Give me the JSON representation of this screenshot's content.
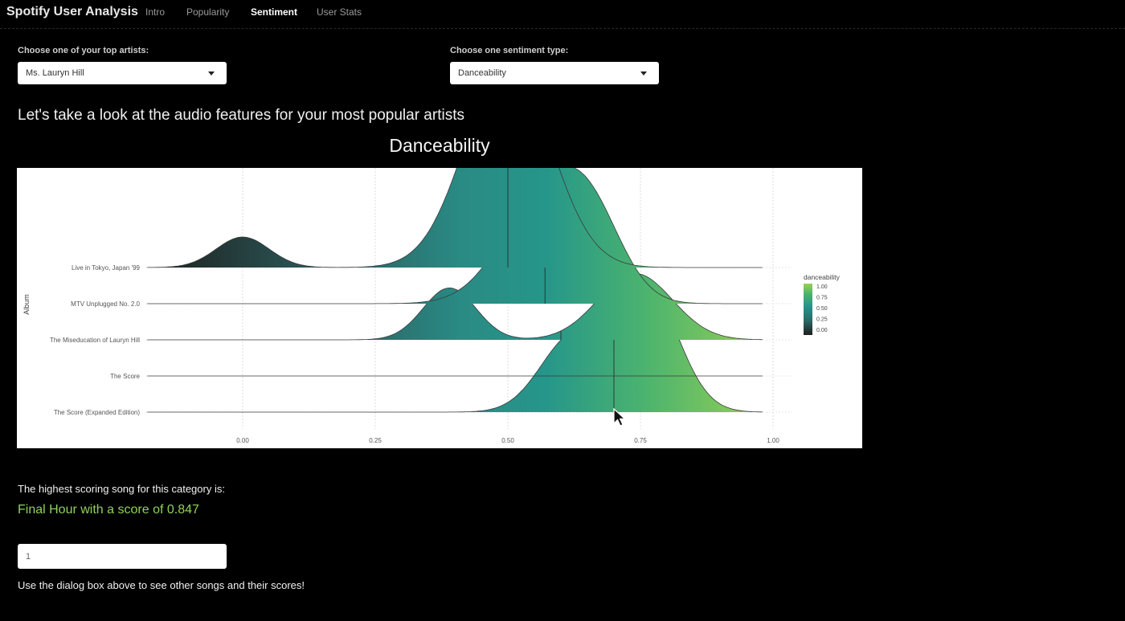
{
  "app": {
    "title": "Spotify User Analysis",
    "tabs": [
      {
        "label": "Intro",
        "active": false
      },
      {
        "label": "Popularity",
        "active": false
      },
      {
        "label": "Sentiment",
        "active": true
      },
      {
        "label": "User Stats",
        "active": false
      }
    ]
  },
  "controls": {
    "artist_label": "Choose one of your top artists:",
    "artist_value": "Ms. Lauryn Hill",
    "sentiment_label": "Choose one sentiment type:",
    "sentiment_value": "Danceability"
  },
  "main": {
    "heading": "Let's take a look at the audio features for your most popular artists",
    "chart_title": "Danceability"
  },
  "chart_data": {
    "type": "ridgeline",
    "title": "Danceability",
    "xlabel": "",
    "ylabel": "Album",
    "xlim": [
      -0.2,
      1.03
    ],
    "x_ticks": [
      0.0,
      0.25,
      0.5,
      0.75,
      1.0
    ],
    "x_tick_labels": [
      "0.00",
      "0.25",
      "0.50",
      "0.75",
      "1.00"
    ],
    "categories": [
      "Live in Tokyo, Japan '99",
      "MTV Unplugged No. 2.0",
      "The Miseducation of Lauryn Hill",
      "The Score",
      "The Score (Expanded Edition)"
    ],
    "series": [
      {
        "name": "Live in Tokyo, Japan '99",
        "median": 0.5,
        "components": [
          {
            "mu": 0.0,
            "sigma": 0.05,
            "w": 0.04
          },
          {
            "mu": 0.5,
            "sigma": 0.08,
            "w": 0.27
          }
        ],
        "range": [
          -0.18,
          0.98
        ]
      },
      {
        "name": "MTV Unplugged No. 2.0",
        "median": 0.57,
        "components": [
          {
            "mu": 0.57,
            "sigma": 0.08,
            "w": 0.14
          },
          {
            "mu": 0.66,
            "sigma": 0.06,
            "w": 0.08
          }
        ],
        "range": [
          -0.18,
          0.98
        ]
      },
      {
        "name": "The Miseducation of Lauryn Hill",
        "median": 0.6,
        "components": [
          {
            "mu": 0.39,
            "sigma": 0.05,
            "w": 0.068
          },
          {
            "mu": 0.74,
            "sigma": 0.07,
            "w": 0.087
          }
        ],
        "range": [
          -0.18,
          0.98
        ]
      },
      {
        "name": "The Score",
        "median": 0.0,
        "components": [],
        "range": [
          -0.18,
          0.98
        ]
      },
      {
        "name": "The Score (Expanded Edition)",
        "median": 0.7,
        "components": [
          {
            "mu": 0.62,
            "sigma": 0.06,
            "w": 0.095
          },
          {
            "mu": 0.76,
            "sigma": 0.06,
            "w": 0.165
          }
        ],
        "range": [
          -0.18,
          0.98
        ]
      }
    ],
    "legend": {
      "title": "danceability",
      "labels": [
        "1.00",
        "0.75",
        "0.50",
        "0.25",
        "0.00"
      ],
      "position": "right",
      "colors": [
        "#1f1f1f",
        "#2a6e6a",
        "#26938a",
        "#3aa57a",
        "#9ad153"
      ]
    },
    "grid": true
  },
  "result": {
    "label": "The highest scoring song for this category is:",
    "song_text": "Final Hour with a score of 0.847"
  },
  "song_input": {
    "value": "1"
  },
  "help_text": "Use the dialog box above to see other songs and their scores!"
}
